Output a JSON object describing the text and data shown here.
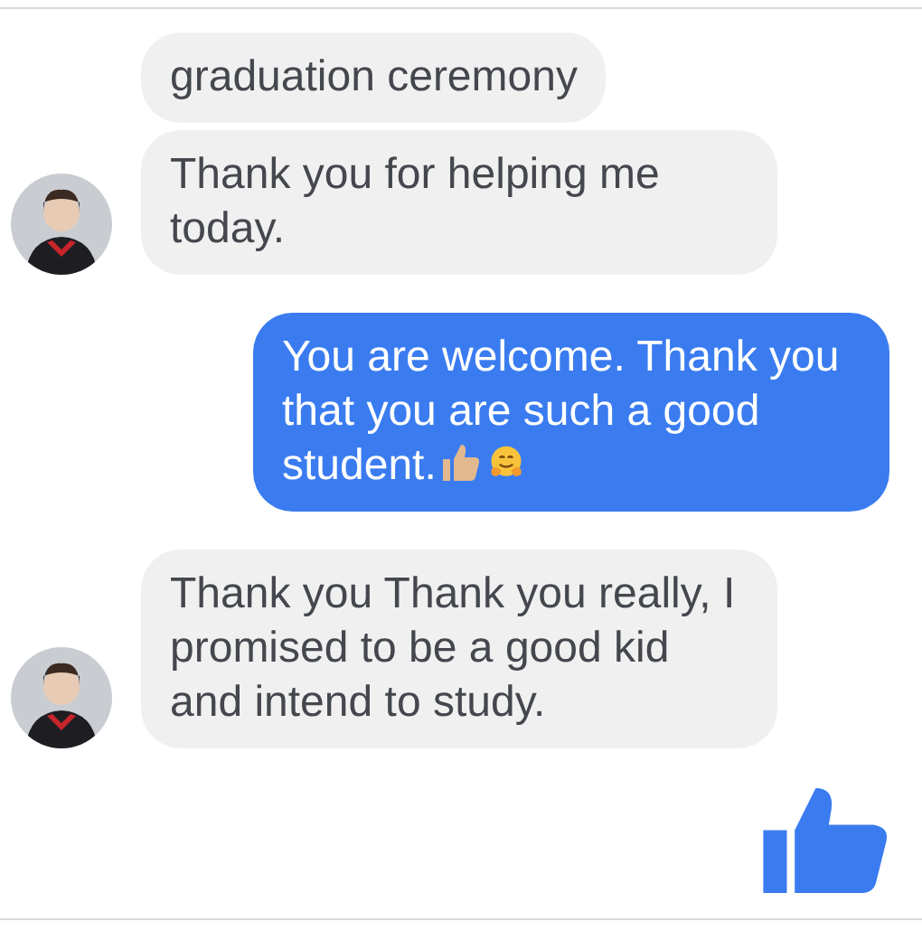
{
  "messages": [
    {
      "kind": "received",
      "avatar": false,
      "text": "graduation ceremony"
    },
    {
      "kind": "received",
      "avatar": true,
      "text": "Thank you for helping me today."
    },
    {
      "kind": "sent",
      "avatar": false,
      "text": "You are welcome. Thank you that you are such a good student."
    },
    {
      "kind": "received",
      "avatar": true,
      "text": "Thank you Thank you really, I promised to be a good kid and intend to study."
    }
  ]
}
